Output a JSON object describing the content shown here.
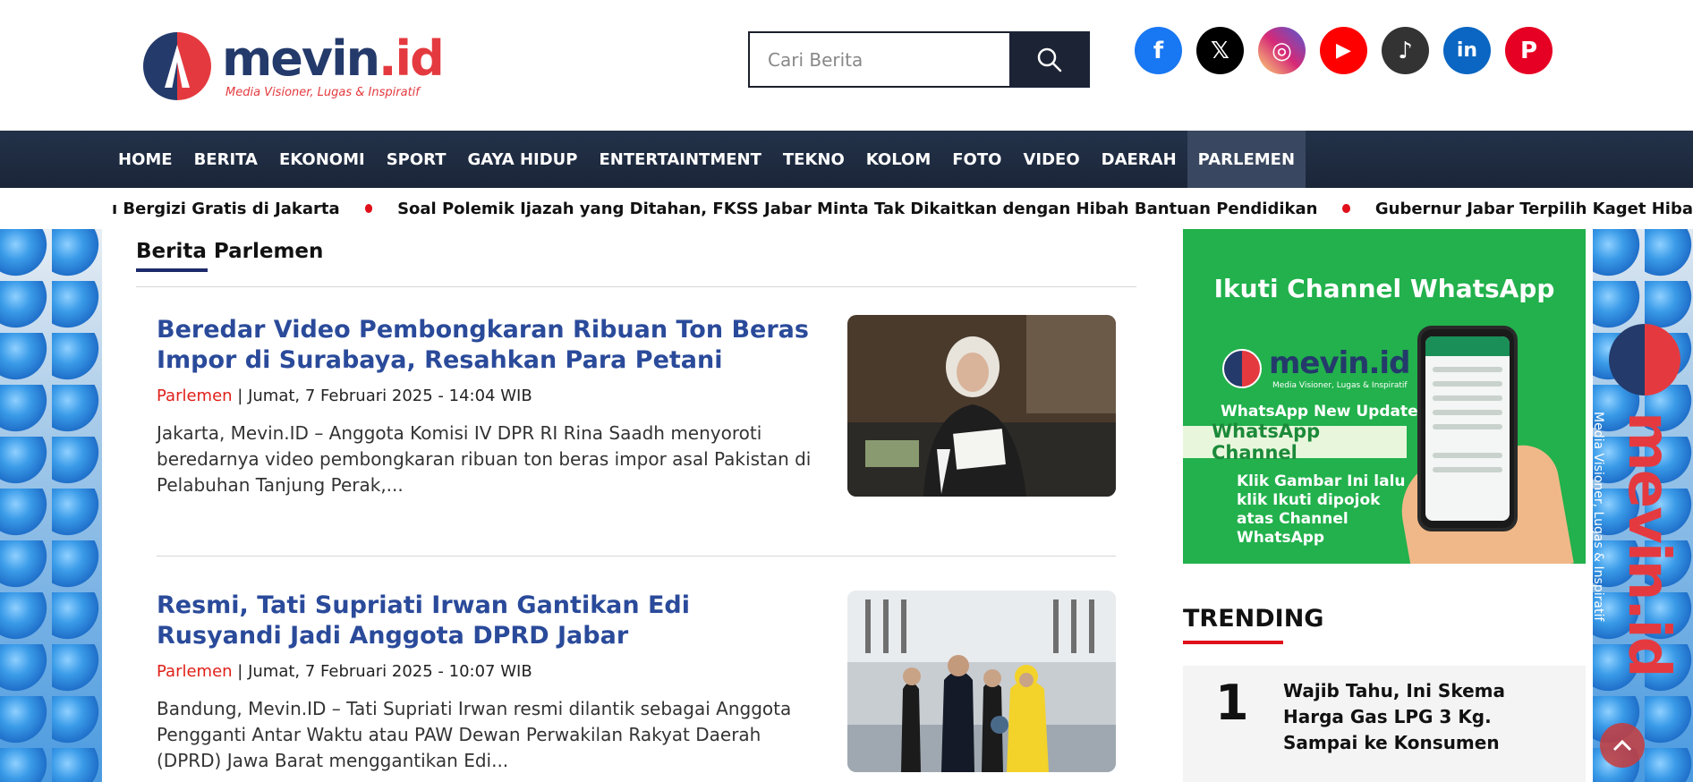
{
  "brand": {
    "name_main": "mevin",
    "name_suffix": ".id",
    "tagline": "Media Visioner, Lugas & Inspiratif"
  },
  "search": {
    "placeholder": "Cari Berita"
  },
  "socials": [
    {
      "icon": "facebook-icon",
      "glyph": "f",
      "color": "#1877f2"
    },
    {
      "icon": "x-icon",
      "glyph": "𝕏",
      "color": "#000000"
    },
    {
      "icon": "instagram-icon",
      "glyph": "◎",
      "color": "#d62976"
    },
    {
      "icon": "youtube-icon",
      "glyph": "▶",
      "color": "#ff0000"
    },
    {
      "icon": "tiktok-icon",
      "glyph": "♪",
      "color": "#333333"
    },
    {
      "icon": "linkedin-icon",
      "glyph": "in",
      "color": "#0a66c2"
    },
    {
      "icon": "pinterest-icon",
      "glyph": "P",
      "color": "#e60023"
    }
  ],
  "nav": {
    "items": [
      "HOME",
      "BERITA",
      "EKONOMI",
      "SPORT",
      "GAYA HIDUP",
      "ENTERTAINTMENT",
      "TEKNO",
      "KOLOM",
      "FOTO",
      "VIDEO",
      "DAERAH",
      "PARLEMEN"
    ],
    "active": "PARLEMEN"
  },
  "ticker": {
    "items": [
      "ı Bergizi Gratis di Jakarta",
      "Soal Polemik Ijazah yang Ditahan, FKSS Jabar Minta Tak Dikaitkan dengan Hibah Bantuan Pendidikan",
      "Gubernur Jabar Terpilih Kaget Hiba"
    ]
  },
  "section": {
    "title": "Berita Parlemen"
  },
  "articles": [
    {
      "title": "Beredar Video Pembongkaran Ribuan Ton Beras Impor di Surabaya, Resahkan Para Petani",
      "category": "Parlemen",
      "date": " | Jumat, 7 Februari 2025 - 14:04 WIB",
      "excerpt": "Jakarta, Mevin.ID – Anggota Komisi IV DPR RI Rina Saadh menyoroti beredarnya video pembongkaran ribuan ton beras impor asal Pakistan di Pelabuhan Tanjung Perak,..."
    },
    {
      "title": "Resmi, Tati Supriati Irwan Gantikan Edi Rusyandi Jadi Anggota DPRD Jabar",
      "category": "Parlemen",
      "date": " | Jumat, 7 Februari 2025 - 10:07 WIB",
      "excerpt": "Bandung, Mevin.ID – Tati Supriati Irwan resmi dilantik sebagai Anggota Pengganti Antar Waktu atau PAW Dewan Perwakilan Rakyat Daerah (DPRD) Jawa Barat menggantikan Edi..."
    }
  ],
  "whatsapp_banner": {
    "title": "Ikuti Channel WhatsApp",
    "logo_main": "mevin.id",
    "logo_tag": "Media Visioner, Lugas & Inspiratif",
    "update": "WhatsApp New Update",
    "channel": "WhatsApp Channel",
    "instruction": "Klik Gambar Ini lalu klik Ikuti dipojok atas Channel WhatsApp"
  },
  "trending": {
    "title": "TRENDING",
    "items": [
      {
        "rank": "1",
        "title": "Wajib Tahu, Ini Skema Harga Gas LPG 3 Kg. Sampai ke Konsumen"
      }
    ]
  },
  "side_brand": {
    "name": "mevin.id",
    "tagline": "Media Visioner, Lugas & Inspiratif"
  },
  "colors": {
    "brand_blue": "#243a6b",
    "brand_red": "#e43a3f",
    "nav_bg": "#1b2538",
    "headline_blue": "#2a4a9a",
    "whatsapp_green": "#22b14c"
  }
}
